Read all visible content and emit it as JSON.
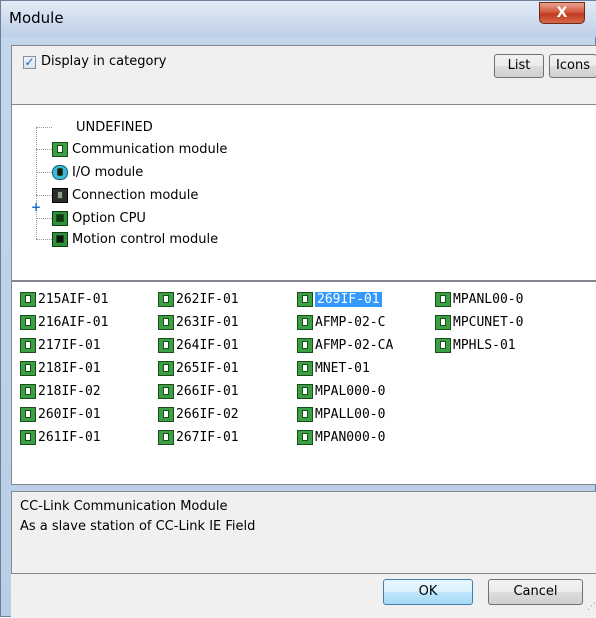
{
  "window": {
    "title": "Module",
    "close_label": "X"
  },
  "options": {
    "display_in_category_label": "Display in category",
    "display_in_category_checked": true,
    "list_button": "List",
    "icons_button": "Icons"
  },
  "tree": {
    "items": [
      {
        "label": "UNDEFINED",
        "icon": "none"
      },
      {
        "label": "Communication module",
        "icon": "communication-module-icon"
      },
      {
        "label": "I/O module",
        "icon": "io-module-icon"
      },
      {
        "label": "Connection module",
        "icon": "connection-module-icon"
      },
      {
        "label": "Option CPU",
        "icon": "option-cpu-icon"
      },
      {
        "label": "Motion control module",
        "icon": "motion-control-module-icon"
      }
    ]
  },
  "modules": {
    "columns": [
      [
        "215AIF-01",
        "216AIF-01",
        "217IF-01",
        "218IF-01",
        "218IF-02",
        "260IF-01",
        "261IF-01"
      ],
      [
        "262IF-01",
        "263IF-01",
        "264IF-01",
        "265IF-01",
        "266IF-01",
        "266IF-02",
        "267IF-01"
      ],
      [
        "269IF-01",
        "AFMP-02-C",
        "AFMP-02-CA",
        "MNET-01",
        "MPAL000-0",
        "MPALL00-0",
        "MPAN000-0"
      ],
      [
        "MPANL00-0",
        "MPCUNET-0",
        "MPHLS-01"
      ]
    ],
    "selected": "269IF-01"
  },
  "description": {
    "line1": "CC-Link Communication Module",
    "line2": "As a slave station of CC-Link IE Field"
  },
  "footer": {
    "ok_label": "OK",
    "cancel_label": "Cancel"
  }
}
